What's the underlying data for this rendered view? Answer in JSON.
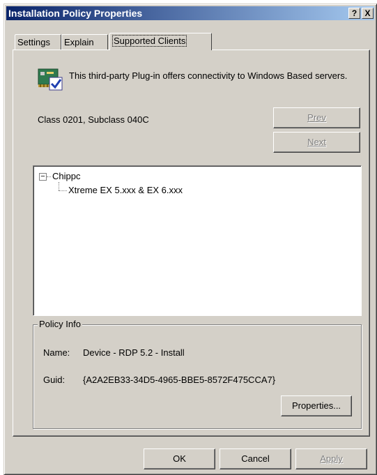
{
  "window": {
    "title": "Installation Policy Properties",
    "help_button": "?",
    "close_button": "X"
  },
  "tabs": [
    {
      "label": "Settings",
      "active": false
    },
    {
      "label": "Explain",
      "active": false
    },
    {
      "label": "Supported Clients",
      "active": true
    }
  ],
  "plugin": {
    "icon": "network-card-icon",
    "description": "This third-party Plug-in offers connectivity to Windows Based servers."
  },
  "class_info": "Class 0201, Subclass 040C",
  "buttons": {
    "prev": "Prev",
    "next": "Next",
    "properties": "Properties...",
    "ok": "OK",
    "cancel": "Cancel",
    "apply": "Apply"
  },
  "tree": {
    "root": "Chippc",
    "child": "Xtreme EX 5.xxx  &  EX 6.xxx"
  },
  "policy_info": {
    "legend": "Policy Info",
    "name_label": "Name:",
    "name_value": "Device - RDP 5.2 - Install",
    "guid_label": "Guid:",
    "guid_value": "{A2A2EB33-34D5-4965-BBE5-8572F475CCA7}"
  },
  "colors": {
    "titlebar_start": "#0a246a",
    "titlebar_end": "#a6caf0",
    "face": "#d4d0c8"
  }
}
